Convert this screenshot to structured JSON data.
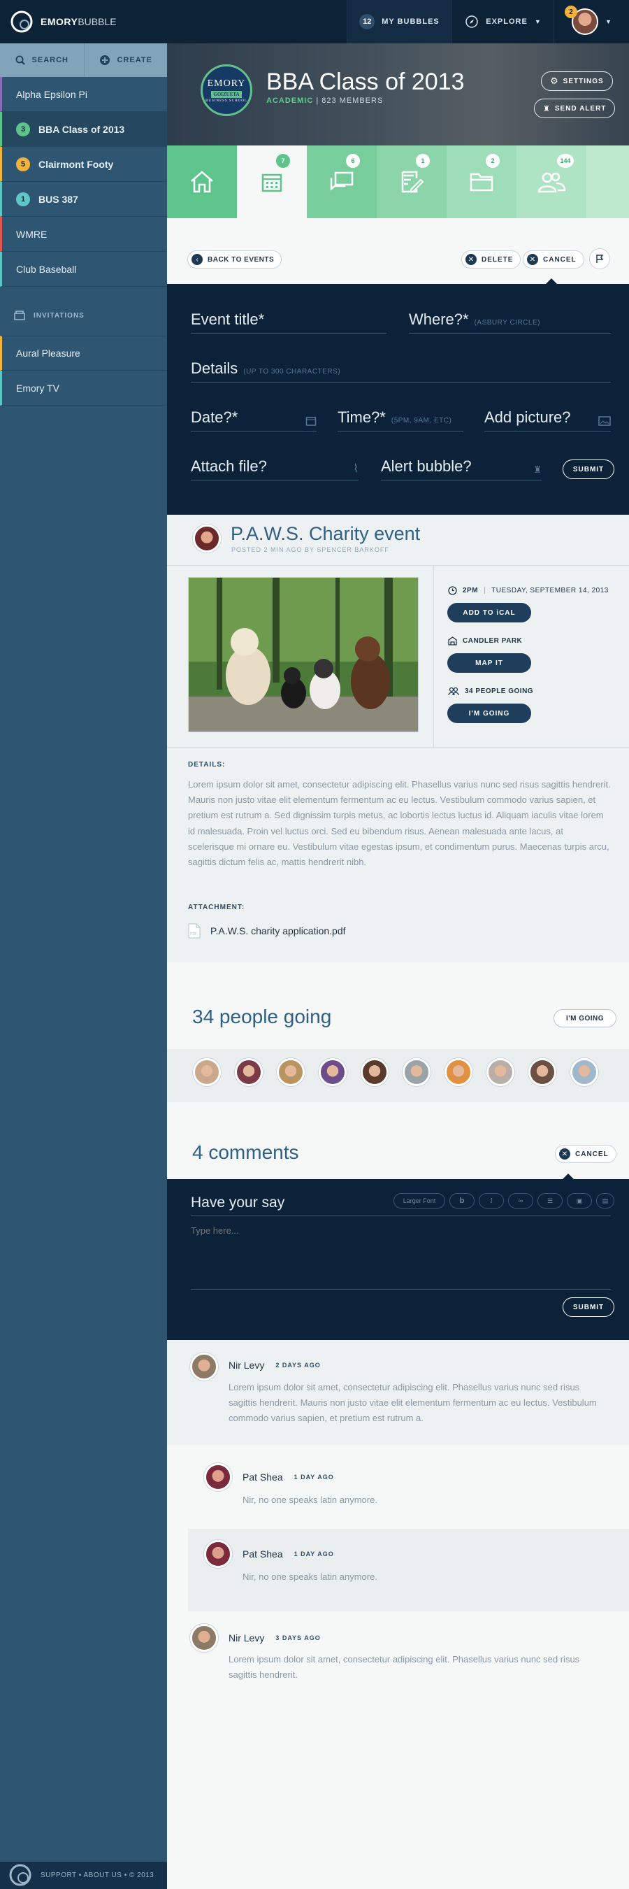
{
  "topbar": {
    "brand_bold": "EMORY",
    "brand_light": "BUBBLE",
    "my_bubbles_count": "12",
    "my_bubbles_label": "MY BUBBLES",
    "explore_label": "EXPLORE",
    "notif_count": "2"
  },
  "sidebar": {
    "search_label": "SEARCH",
    "create_label": "CREATE",
    "bubbles": [
      {
        "label": "Alpha Epsilon Pi",
        "badge": "",
        "accent": "#8a6bb7"
      },
      {
        "label": "BBA Class of 2013",
        "badge": "3",
        "accent": "#5dc48b"
      },
      {
        "label": "Clairmont Footy",
        "badge": "5",
        "accent": "#f2b33d"
      },
      {
        "label": "BUS 387",
        "badge": "1",
        "accent": "#5ec7c6"
      },
      {
        "label": "WMRE",
        "badge": "",
        "accent": "#e0574f"
      },
      {
        "label": "Club Baseball",
        "badge": "",
        "accent": "#5ec7c6"
      }
    ],
    "invitations_label": "INVITATIONS",
    "invitations": [
      {
        "label": "Aural Pleasure",
        "accent": "#f2b33d"
      },
      {
        "label": "Emory TV",
        "accent": "#5ec7c6"
      }
    ],
    "footer": "SUPPORT • ABOUT US • © 2013"
  },
  "header": {
    "logo_top": "EMORY",
    "logo_mid": "GOIZUETA",
    "logo_bottom": "BUSINESS SCHOOL",
    "title": "BBA Class of 2013",
    "category": "ACADEMIC",
    "members": "823 MEMBERS",
    "settings_label": "SETTINGS",
    "send_alert_label": "SEND ALERT"
  },
  "tabs": [
    {
      "name": "home",
      "badge": ""
    },
    {
      "name": "events",
      "badge": "7"
    },
    {
      "name": "discussions",
      "badge": "6"
    },
    {
      "name": "notes",
      "badge": "1"
    },
    {
      "name": "files",
      "badge": "2"
    },
    {
      "name": "members",
      "badge": "144"
    }
  ],
  "strip": {
    "back_label": "BACK TO EVENTS",
    "delete_label": "DELETE",
    "cancel_label": "CANCEL"
  },
  "form": {
    "title_label": "Event title*",
    "where_label": "Where?*",
    "where_hint": "(ASBURY CIRCLE)",
    "details_label": "Details",
    "details_hint": "(UP TO 300 CHARACTERS)",
    "date_label": "Date?*",
    "time_label": "Time?*",
    "time_hint": "(5PM, 9AM, ETC)",
    "picture_label": "Add picture?",
    "attach_label": "Attach file?",
    "alert_label": "Alert bubble?",
    "submit_label": "SUBMIT"
  },
  "event": {
    "title": "P.A.W.S. Charity event",
    "posted": "POSTED 2 MIN AGO BY SPENCER BARKOFF",
    "time": "2PM",
    "date": "TUESDAY, SEPTEMBER 14, 2013",
    "ical_label": "ADD TO iCAL",
    "location": "CANDLER PARK",
    "map_label": "MAP IT",
    "going_count": "34 PEOPLE GOING",
    "going_btn": "I'M GOING",
    "details_heading": "DETAILS:",
    "details_text": "Lorem ipsum dolor sit amet, consectetur adipiscing elit. Phasellus varius nunc sed risus sagittis hendrerit. Mauris non justo vitae elit elementum fermentum ac eu lectus. Vestibulum commodo varius sapien, et pretium est rutrum a. Sed dignissim turpis metus, ac lobortis lectus luctus id. Aliquam iaculis vitae lorem id malesuada. Proin vel luctus orci. Sed eu bibendum risus. Aenean malesuada ante lacus, at scelerisque mi ornare eu. Vestibulum vitae egestas ipsum, et condimentum purus. Maecenas turpis arcu, sagittis dictum felis ac, mattis hendrerit nibh.",
    "attachment_heading": "ATTACHMENT:",
    "attachment_file": "P.A.W.S. charity application.pdf"
  },
  "going": {
    "heading": "34 people going",
    "button": "I'M GOING",
    "avatar_colors": [
      "#c9a98c",
      "#7a3b46",
      "#b89460",
      "#6c4d8a",
      "#5a3a2a",
      "#9aa3a8",
      "#e09040",
      "#b8b0a8",
      "#6a5040",
      "#9fb8cc"
    ]
  },
  "comments": {
    "heading": "4 comments",
    "cancel_label": "CANCEL",
    "have_your_say": "Have your say",
    "larger_font": "Larger Font",
    "placeholder": "Type here...",
    "submit_label": "SUBMIT",
    "items": [
      {
        "name": "Nir Levy",
        "time": "2 DAYS AGO",
        "text": "Lorem ipsum dolor sit amet, consectetur adipiscing elit. Phasellus varius nunc sed risus sagittis hendrerit. Mauris non justo vitae elit elementum fermentum ac eu lectus. Vestibulum commodo varius sapien, et pretium est rutrum a."
      },
      {
        "name": "Pat Shea",
        "time": "1 DAY AGO",
        "text": "Nir, no one speaks latin anymore."
      },
      {
        "name": "Pat Shea",
        "time": "1 DAY AGO",
        "text": "Nir, no one speaks latin anymore."
      },
      {
        "name": "Nir Levy",
        "time": "3 DAYS AGO",
        "text": "Lorem ipsum dolor sit amet, consectetur adipiscing elit. Phasellus varius nunc sed risus sagittis hendrerit."
      }
    ]
  }
}
